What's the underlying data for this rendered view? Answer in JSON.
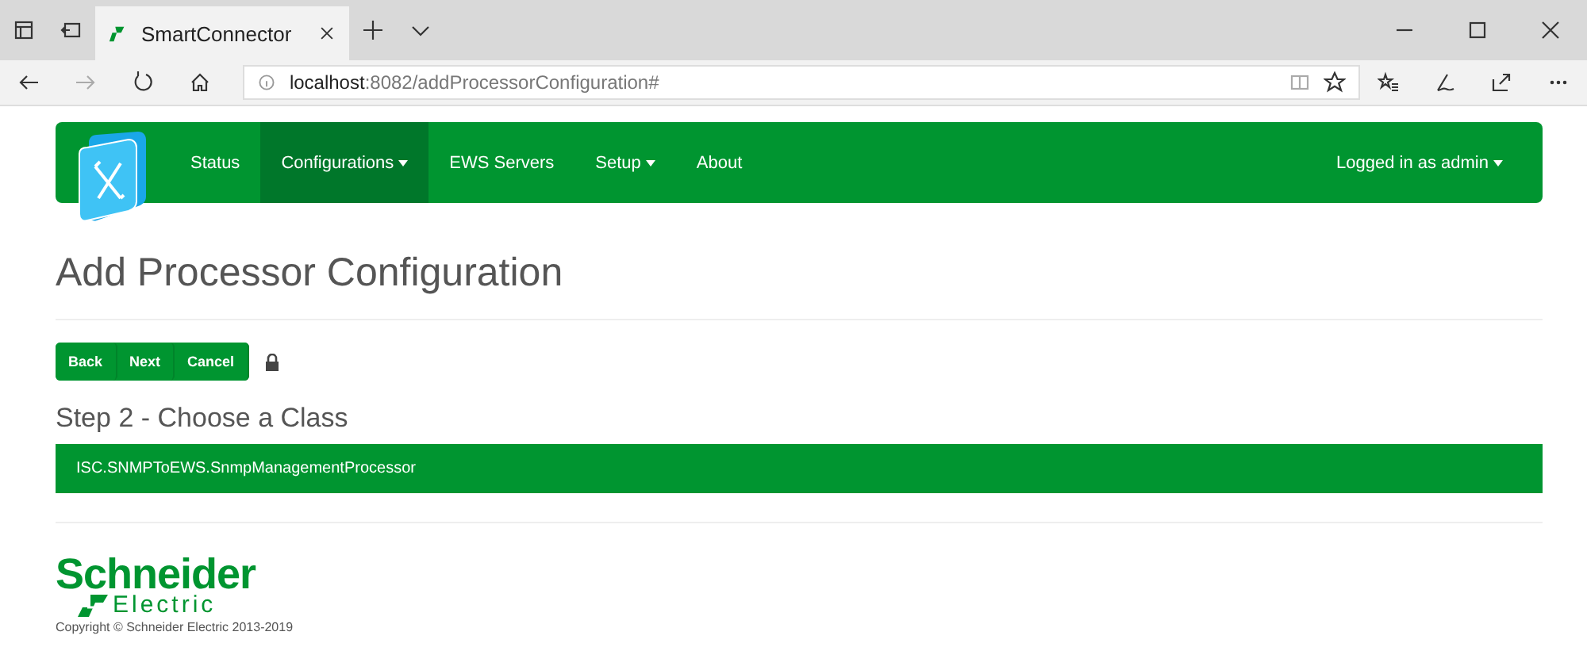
{
  "browser": {
    "tab_title": "SmartConnector",
    "url_host": "localhost",
    "url_path": ":8082/addProcessorConfiguration#"
  },
  "navbar": {
    "items": [
      {
        "label": "Status",
        "selected": false,
        "dropdown": false
      },
      {
        "label": "Configurations",
        "selected": true,
        "dropdown": true
      },
      {
        "label": "EWS Servers",
        "selected": false,
        "dropdown": false
      },
      {
        "label": "Setup",
        "selected": false,
        "dropdown": true
      },
      {
        "label": "About",
        "selected": false,
        "dropdown": false
      }
    ],
    "user": {
      "label": "Logged in as admin",
      "dropdown": true
    }
  },
  "title": "Add Processor Configuration",
  "buttons": [
    "Back",
    "Next",
    "Cancel"
  ],
  "step_heading": "Step 2 - Choose a Class",
  "classes": [
    {
      "name": "ISC.SNMPToEWS.SnmpManagementProcessor"
    }
  ],
  "footer": {
    "logo_top": "Schneider",
    "logo_bottom": "Electric",
    "copyright": "Copyright © Schneider Electric 2013-2019"
  }
}
